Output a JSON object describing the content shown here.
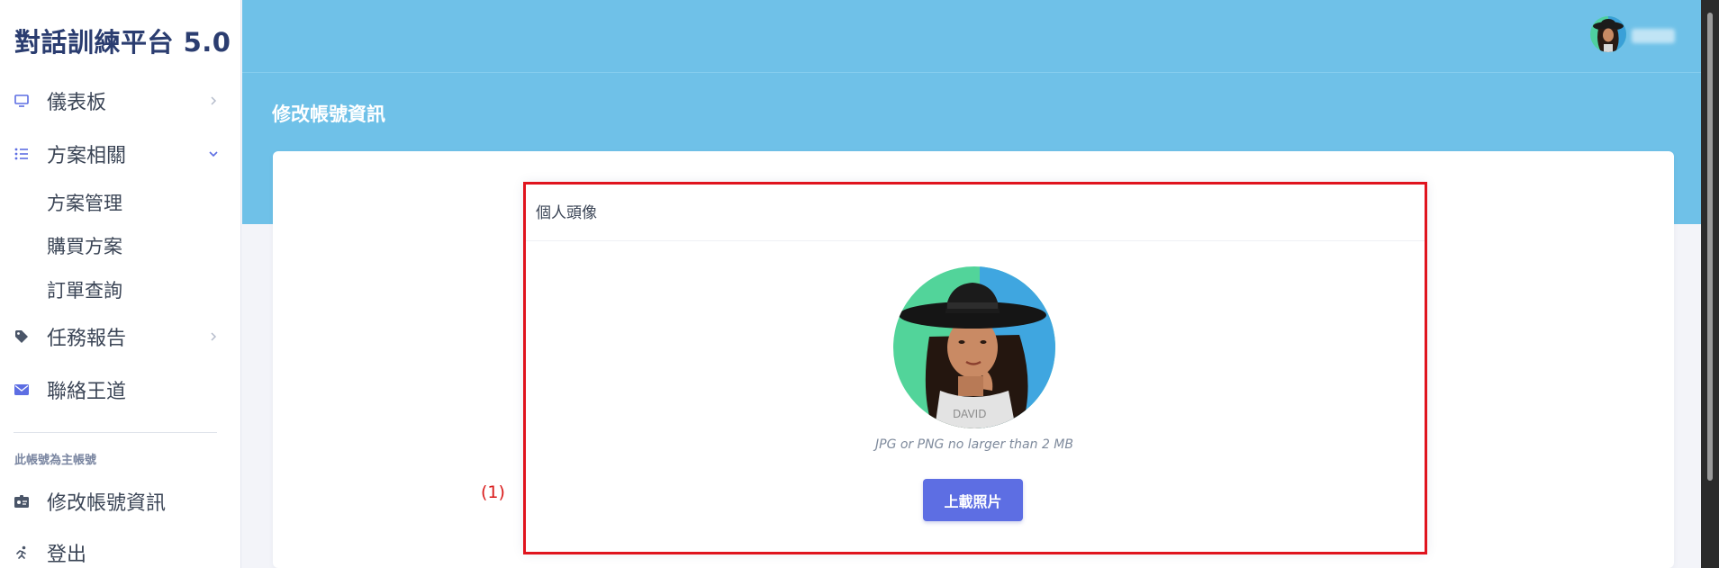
{
  "app": {
    "brand": "對話訓練平台 5.0"
  },
  "sidebar": {
    "items": [
      {
        "label": "儀表板",
        "icon": "monitor-icon"
      },
      {
        "label": "方案相關",
        "icon": "list-icon"
      },
      {
        "label": "任務報告",
        "icon": "tag-icon"
      },
      {
        "label": "聯絡王道",
        "icon": "envelope-icon"
      }
    ],
    "sub_items": [
      "方案管理",
      "購買方案",
      "訂單查詢"
    ],
    "section_title": "此帳號為主帳號",
    "account_items": [
      {
        "label": "修改帳號資訊",
        "icon": "id-card-icon"
      },
      {
        "label": "登出",
        "icon": "running-icon"
      }
    ]
  },
  "header": {
    "page_title": "修改帳號資訊"
  },
  "avatar_card": {
    "title": "個人頭像",
    "hint": "JPG or PNG no larger than 2 MB",
    "upload_label": "上載照片"
  },
  "annotation": {
    "label": "(1)"
  },
  "colors": {
    "header_bg": "#6fc1e8",
    "brand_text": "#2b3d70",
    "primary_button": "#5d6ee3",
    "highlight": "#e0141e"
  }
}
